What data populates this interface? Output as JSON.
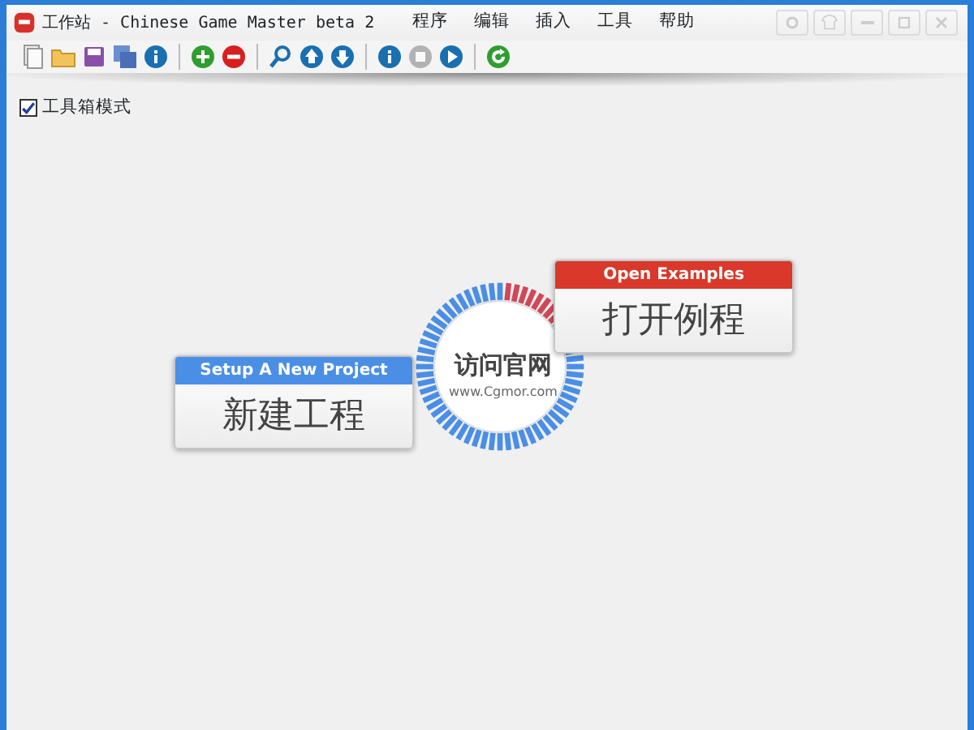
{
  "window": {
    "title": "工作站 - Chinese Game Master beta 2"
  },
  "menu": [
    "程序",
    "编辑",
    "插入",
    "工具",
    "帮助"
  ],
  "toolbar": [
    [
      {
        "kind": "copy",
        "disabled": false
      },
      {
        "kind": "open",
        "disabled": false
      },
      {
        "kind": "save",
        "disabled": false
      },
      {
        "kind": "saveall",
        "disabled": false
      },
      {
        "kind": "info",
        "disabled": false
      }
    ],
    [
      {
        "kind": "add",
        "disabled": false
      },
      {
        "kind": "remove",
        "disabled": false
      }
    ],
    [
      {
        "kind": "search",
        "disabled": false
      },
      {
        "kind": "up",
        "disabled": false
      },
      {
        "kind": "down",
        "disabled": false
      }
    ],
    [
      {
        "kind": "info",
        "disabled": false
      },
      {
        "kind": "stop",
        "disabled": true
      },
      {
        "kind": "play",
        "disabled": false
      }
    ],
    [
      {
        "kind": "refresh",
        "disabled": false
      }
    ]
  ],
  "toolbox_mode": {
    "label": "工具箱模式",
    "checked": true
  },
  "hub": {
    "title": "访问官网",
    "url": "www.Cgmor.com"
  },
  "actions": [
    {
      "header": "Open Examples",
      "label": "打开例程",
      "color": "#d9382a"
    },
    {
      "header": "Setup A New Project",
      "label": "新建工程",
      "color": "#4a8ee6"
    }
  ]
}
